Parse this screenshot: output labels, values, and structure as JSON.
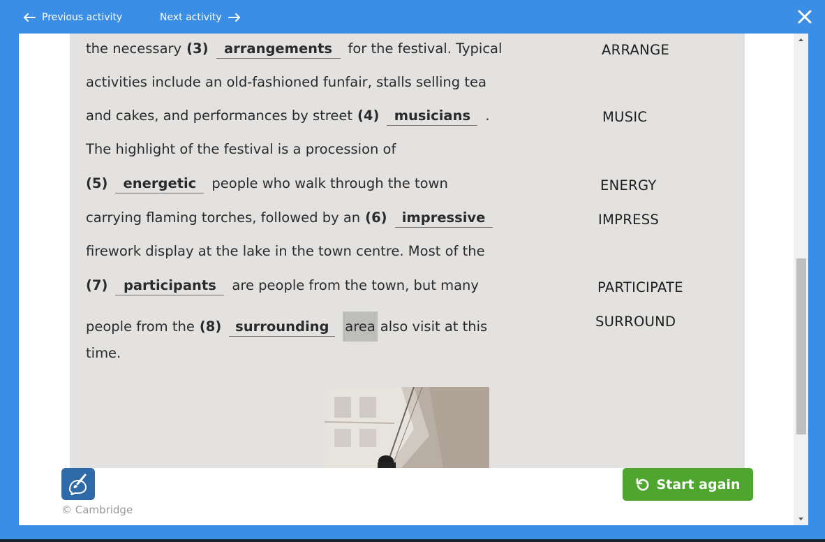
{
  "nav": {
    "previous_label": "Previous activity",
    "next_label": "Next activity",
    "icons": {
      "previous": "arrow-left-icon",
      "next": "arrow-right-icon",
      "close": "close-icon"
    }
  },
  "exercise": {
    "lines": [
      {
        "num": "",
        "pre": "the necessary",
        "gap_num": "(3)",
        "answer": "arrangements",
        "post": "for the festival. Typical"
      },
      {
        "text": "activities include an old-fashioned funfair, stalls selling tea"
      },
      {
        "pre": "and cakes, and performances by street",
        "gap_num": "(4)",
        "answer": "musicians",
        "post": "."
      },
      {
        "text": "The highlight of the festival is a procession of"
      },
      {
        "gap_num": "(5)",
        "answer": "energetic",
        "post": "people who walk through the town"
      },
      {
        "pre": "carrying flaming torches, followed by an",
        "gap_num": "(6)",
        "answer": "impressive"
      },
      {
        "text": "firework display at the lake in the town centre. Most of the"
      },
      {
        "gap_num": "(7)",
        "answer": "participants",
        "post": "are people from the town, but many"
      },
      {
        "pre": "people from the",
        "gap_num": "(8)",
        "answer": "surrounding",
        "highlight": "area",
        "post": "also visit at this"
      },
      {
        "text": "time."
      }
    ],
    "keywords": [
      "ARRANGE",
      "MUSIC",
      "ENERGY",
      "IMPRESS",
      "PARTICIPATE",
      "SURROUND"
    ]
  },
  "footer": {
    "copyright": "© Cambridge",
    "start_again_label": "Start again",
    "icons": {
      "tool": "brush-speech-icon",
      "restart": "restart-icon"
    }
  },
  "colors": {
    "primary_blue": "#3a8ee6",
    "content_bg": "#e3e2e0",
    "start_green": "#4ea62e",
    "tool_blue": "#2e6aa8"
  }
}
